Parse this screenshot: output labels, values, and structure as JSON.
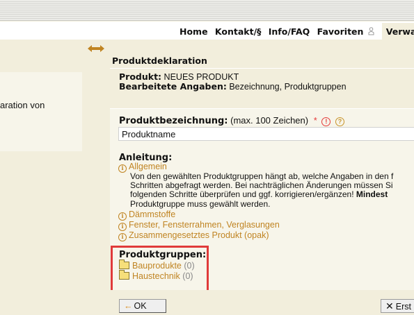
{
  "nav": {
    "items": [
      "Home",
      "Kontakt/§",
      "Info/FAQ",
      "Favoriten"
    ],
    "active": "Verwalt"
  },
  "left_panel": {
    "text": "aration von"
  },
  "main": {
    "title": "Produktdeklaration",
    "product_label": "Produkt:",
    "product_value": "NEUES PRODUKT",
    "edited_label": "Bearbeitete Angaben:",
    "edited_value": "Bezeichnung, Produktgruppen"
  },
  "form": {
    "name_label": "Produktbezeichnung:",
    "name_hint": "(max. 100 Zeichen)",
    "required_mark": "*",
    "name_value": "Produktname",
    "instructions_title": "Anleitung:",
    "general_link": "Allgemein",
    "instructions_lines": [
      "Von den gewählten Produktgruppen hängt ab, welche Angaben in den f",
      "Schritten abgefragt werden. Bei nachträglichen Änderungen müssen Si",
      "folgenden Schritte überprüfen und ggf. korrigieren/ergänzen!",
      "Mindest",
      "Produktgruppe muss gewählt werden."
    ],
    "info_links": [
      "Dämmstoffe",
      "Fenster, Fensterrahmen, Verglasungen",
      "Zusammengesetztes Produkt (opak)"
    ],
    "groups_title": "Produktgruppen:",
    "groups": [
      {
        "name": "Bauprodukte",
        "count": "(0)"
      },
      {
        "name": "Haustechnik",
        "count": "(0)"
      }
    ]
  },
  "buttons": {
    "ok": "OK",
    "next": "Erst"
  },
  "colors": {
    "highlight": "#e03a3a",
    "link": "#c08422",
    "background": "#f2eedc"
  }
}
